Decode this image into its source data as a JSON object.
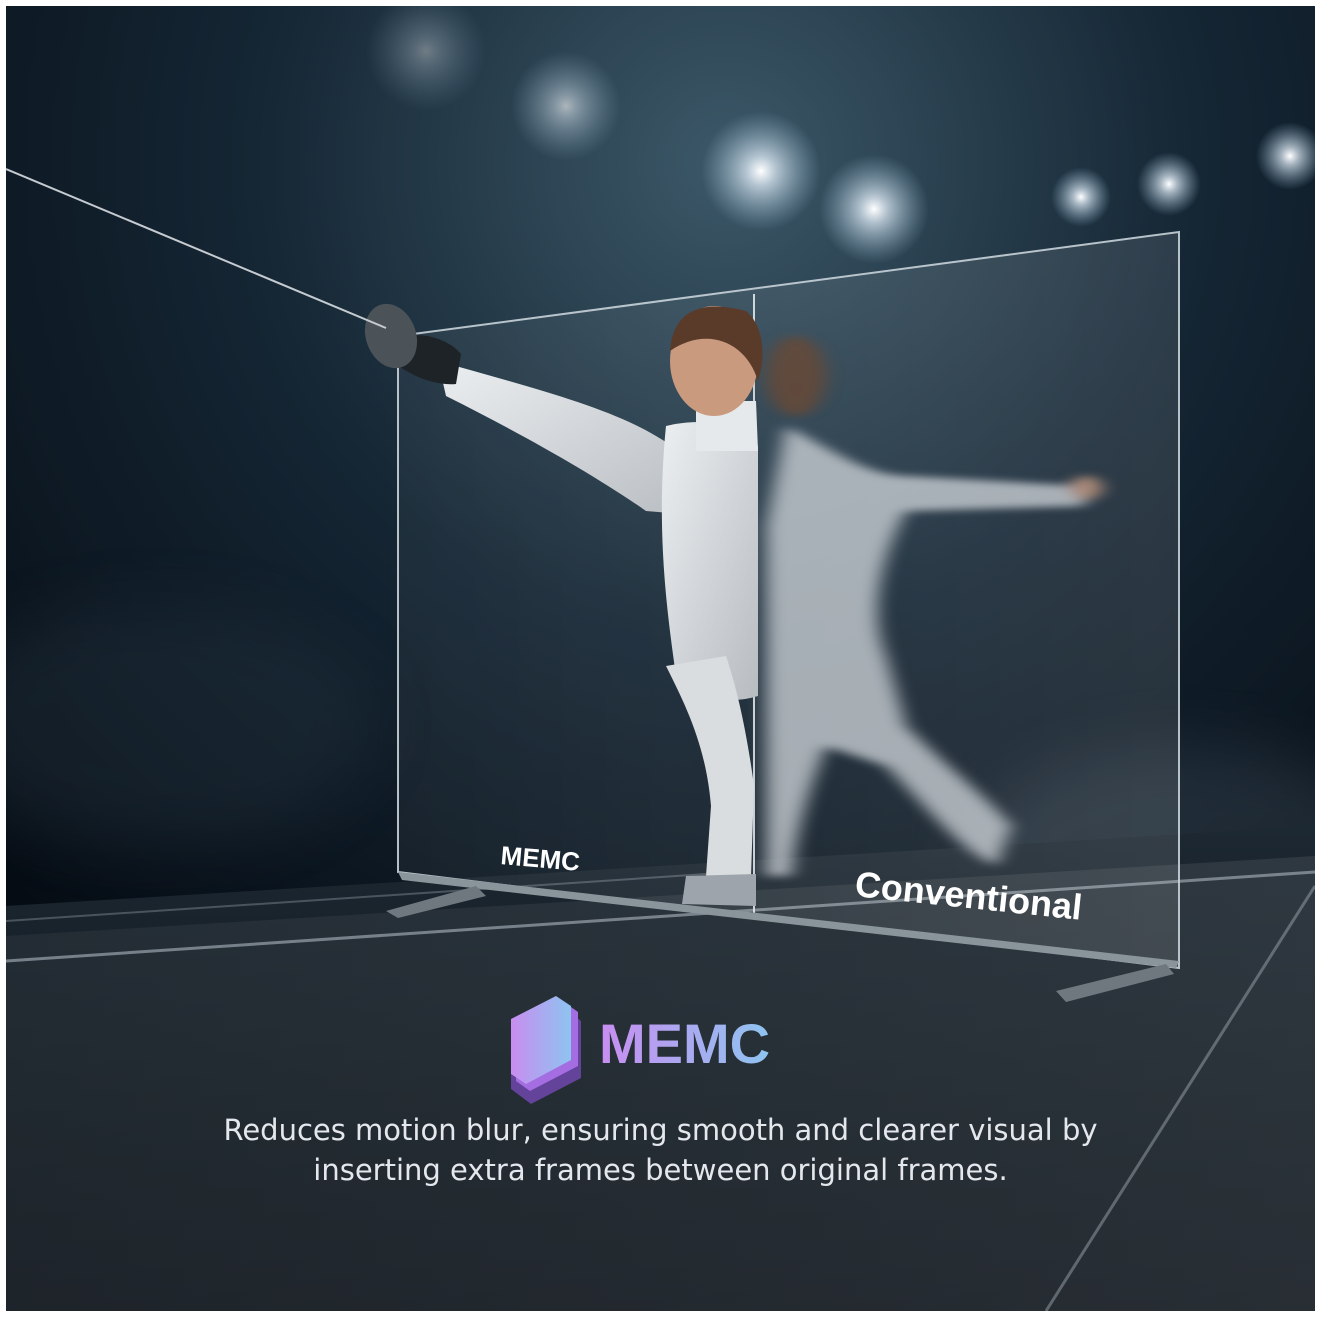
{
  "labels": {
    "memc_panel": "MEMC",
    "conventional_panel": "Conventional"
  },
  "brand": {
    "title": "MEMC",
    "icon": "stacked-frames-icon",
    "gradient_start": "#c88df0",
    "gradient_end": "#8ec4f0"
  },
  "caption": {
    "line1": "Reduces motion blur, ensuring smooth and clearer visual by",
    "line2": "inserting extra frames between original frames."
  }
}
